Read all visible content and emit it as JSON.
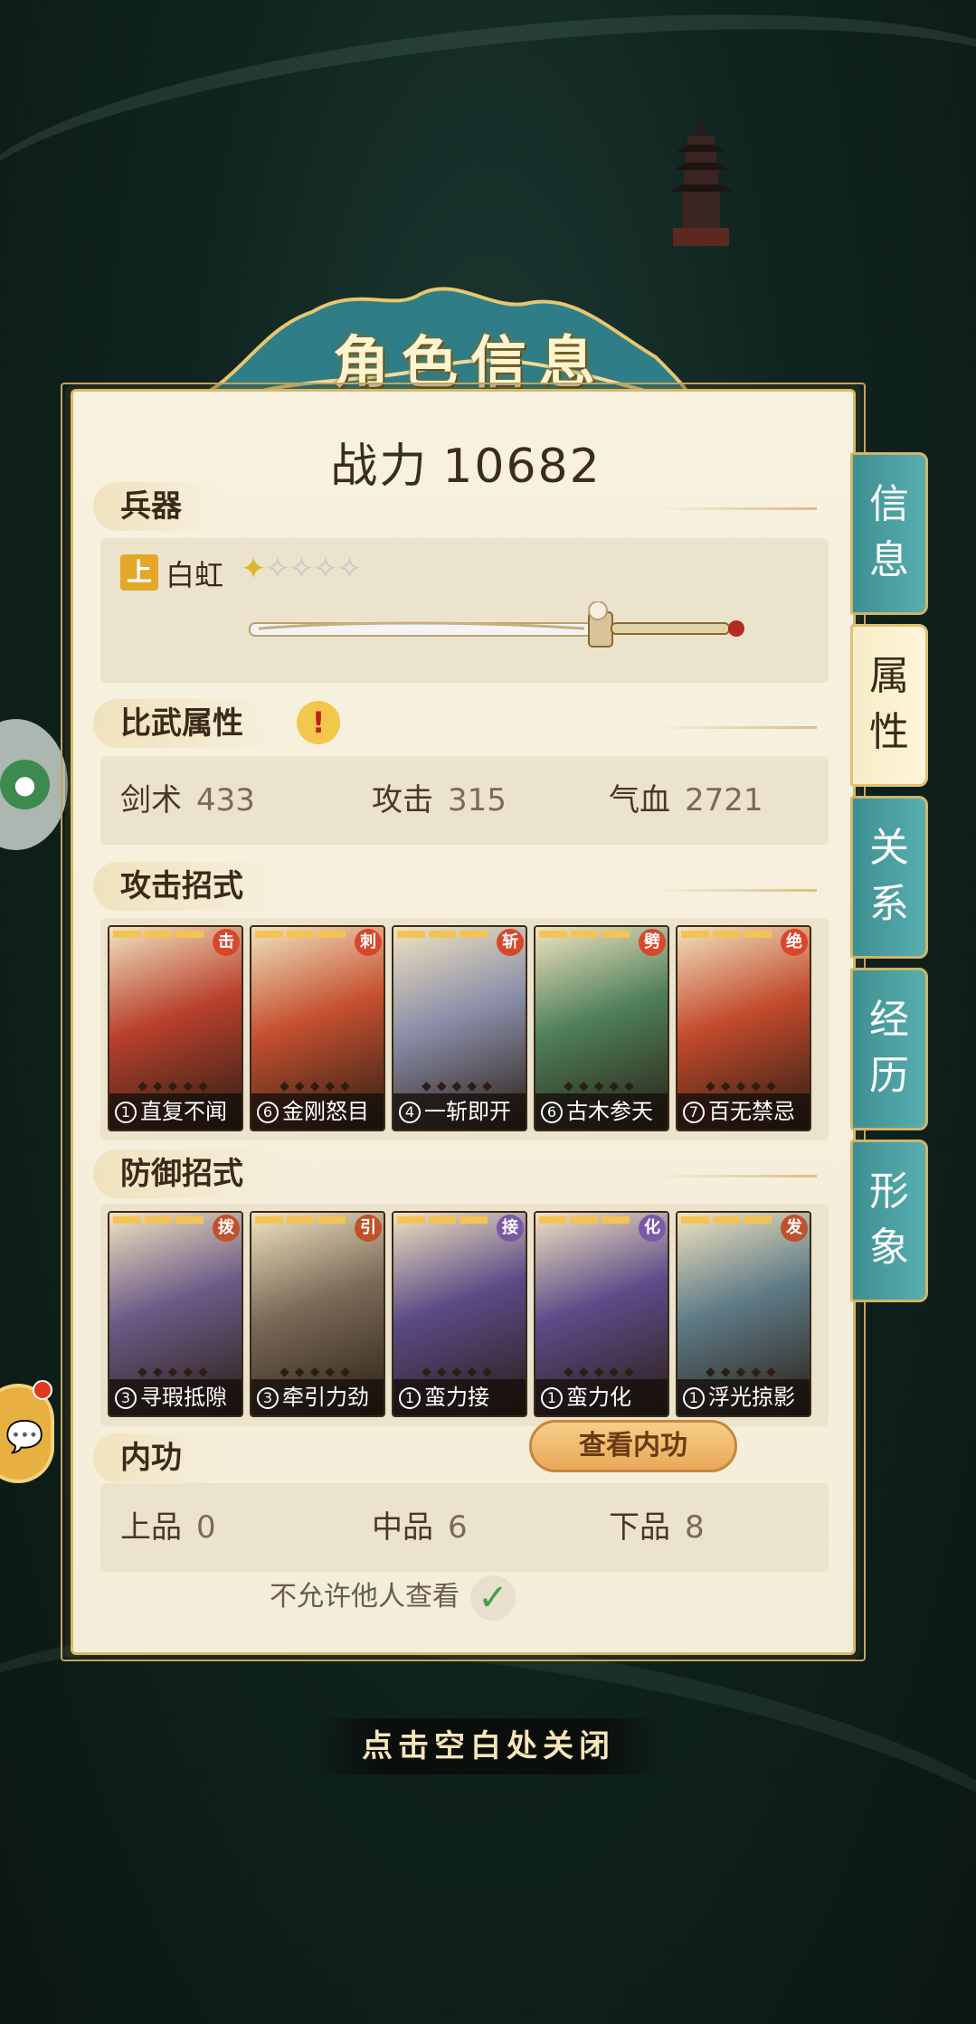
{
  "header": {
    "title": "角色信息"
  },
  "power": {
    "label": "战力",
    "value": "10682"
  },
  "weapon": {
    "section": "兵器",
    "grade": "上",
    "name": "白虹",
    "stars_filled": 1,
    "stars_total": 5
  },
  "combat_stats": {
    "section": "比武属性",
    "alert_icon": "exclamation-icon",
    "items": [
      {
        "label": "剑术",
        "value": "433"
      },
      {
        "label": "攻击",
        "value": "315"
      },
      {
        "label": "气血",
        "value": "2721"
      }
    ]
  },
  "attack_skills": {
    "section": "攻击招式",
    "cards": [
      {
        "level": "1",
        "name": "直复不闻",
        "tag": "击",
        "tag_color": "#d9472b",
        "bg": "#b8402c"
      },
      {
        "level": "6",
        "name": "金刚怒目",
        "tag": "刺",
        "tag_color": "#d9472b",
        "bg": "#c5502f"
      },
      {
        "level": "4",
        "name": "一斩即开",
        "tag": "斩",
        "tag_color": "#d9472b",
        "bg": "#8a8ea8"
      },
      {
        "level": "6",
        "name": "古木参天",
        "tag": "劈",
        "tag_color": "#d9472b",
        "bg": "#4e7f5a"
      },
      {
        "level": "7",
        "name": "百无禁忌",
        "tag": "绝",
        "tag_color": "#d9472b",
        "bg": "#c24a2c"
      }
    ]
  },
  "defense_skills": {
    "section": "防御招式",
    "cards": [
      {
        "level": "3",
        "name": "寻瑕抵隙",
        "tag": "拨",
        "tag_color": "#c0522b",
        "bg": "#6c5a86"
      },
      {
        "level": "3",
        "name": "牵引力劲",
        "tag": "引",
        "tag_color": "#c0522b",
        "bg": "#7a6a58"
      },
      {
        "level": "1",
        "name": "蛮力接",
        "tag": "接",
        "tag_color": "#7a5aa6",
        "bg": "#5a4a86"
      },
      {
        "level": "1",
        "name": "蛮力化",
        "tag": "化",
        "tag_color": "#7a5aa6",
        "bg": "#5c4b88"
      },
      {
        "level": "1",
        "name": "浮光掠影",
        "tag": "发",
        "tag_color": "#c0522b",
        "bg": "#5e7a86"
      }
    ]
  },
  "inner_skill": {
    "section": "内功",
    "view_button": "查看内功",
    "items": [
      {
        "label": "上品",
        "value": "0"
      },
      {
        "label": "中品",
        "value": "6"
      },
      {
        "label": "下品",
        "value": "8"
      }
    ]
  },
  "privacy": {
    "label": "不允许他人查看",
    "checked": true
  },
  "tabs": [
    {
      "label": "信息",
      "active": false
    },
    {
      "label": "属性",
      "active": true
    },
    {
      "label": "关系",
      "active": false
    },
    {
      "label": "经历",
      "active": false
    },
    {
      "label": "形象",
      "active": false
    }
  ],
  "close_hint": "点击空白处关闭"
}
